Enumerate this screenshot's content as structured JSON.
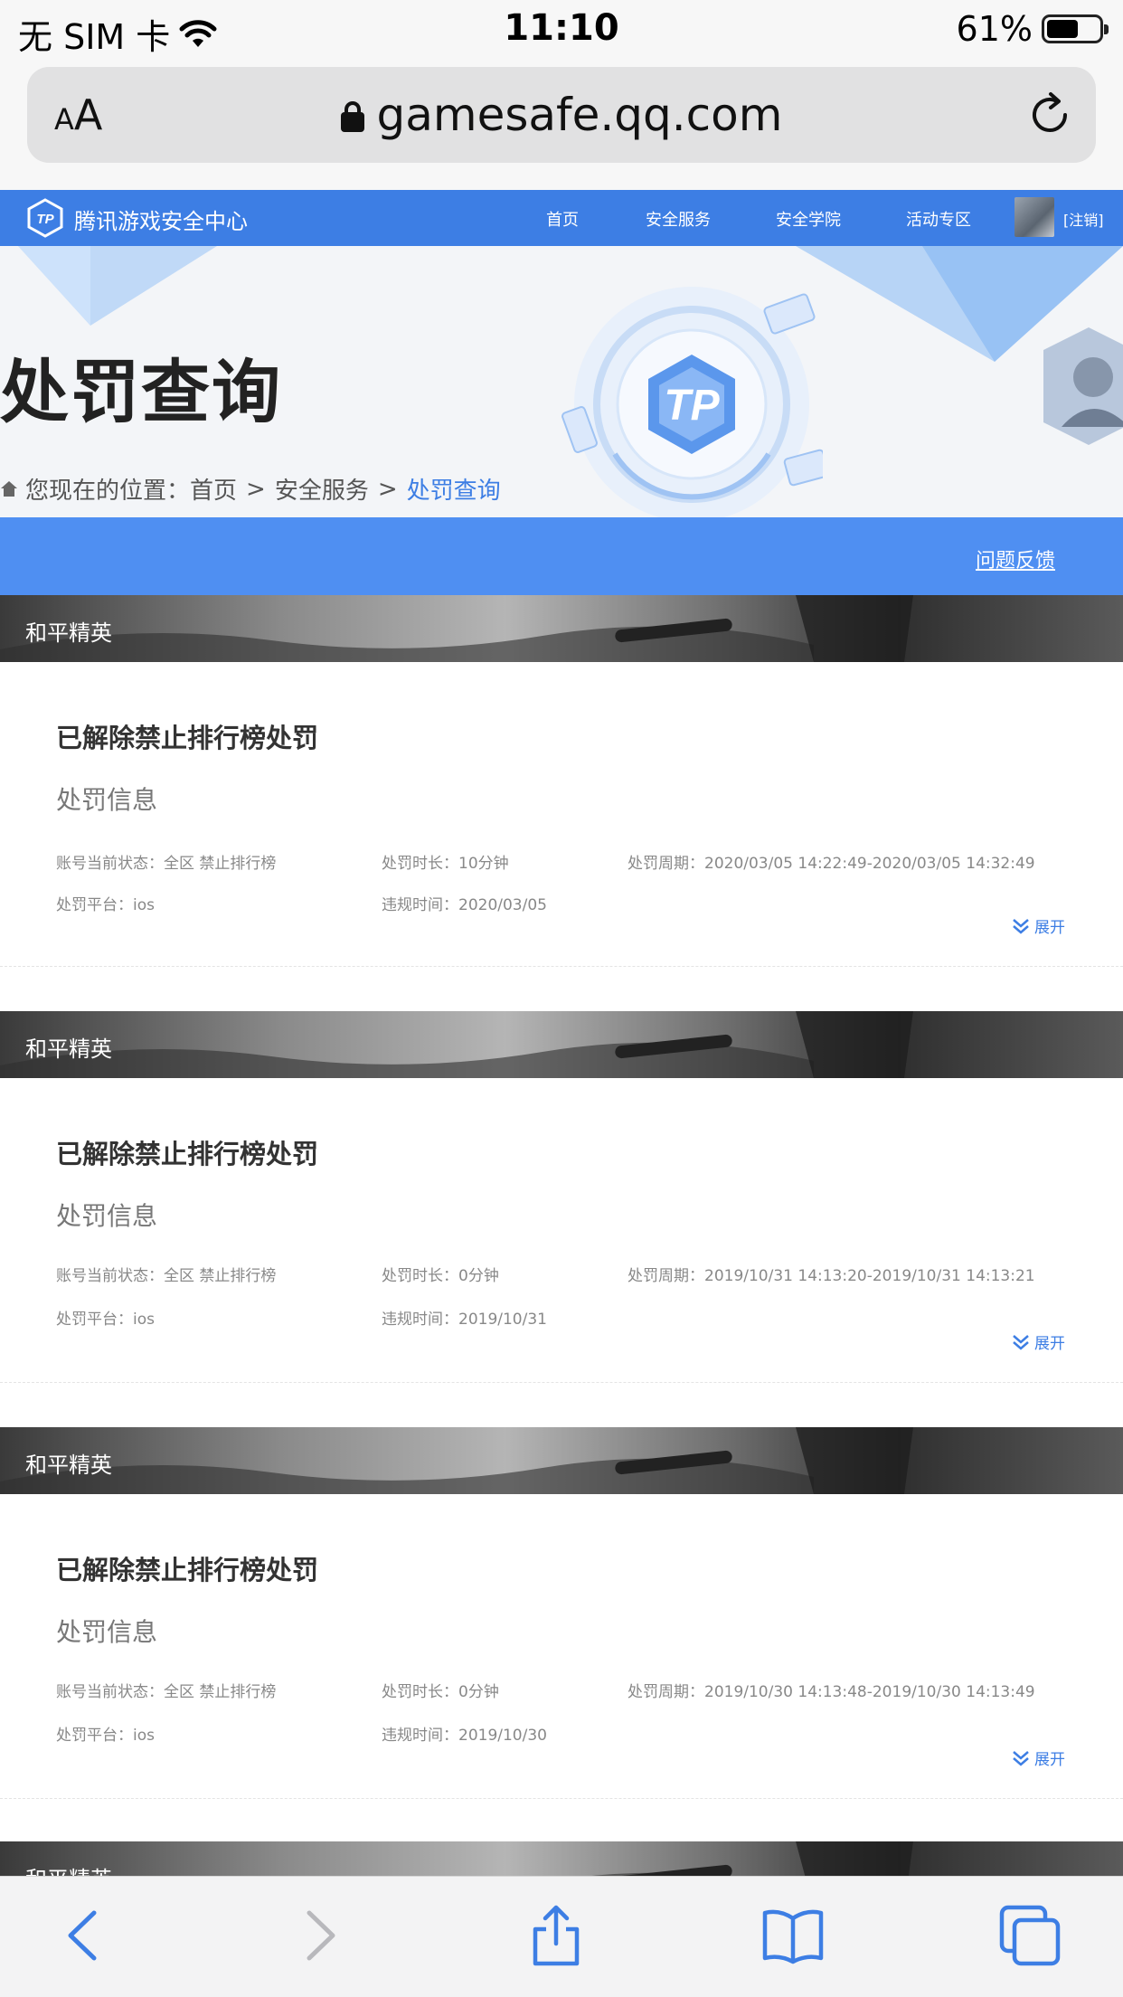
{
  "status_bar": {
    "carrier": "无 SIM 卡",
    "time": "11:10",
    "battery": "61%",
    "battery_level": 0.61
  },
  "safari": {
    "reader_label_small": "A",
    "reader_label_large": "A",
    "url": "gamesafe.qq.com"
  },
  "site": {
    "name": "腾讯游戏安全中心",
    "nav": [
      "首页",
      "安全服务",
      "安全学院",
      "活动专区"
    ],
    "logout": "[注销]"
  },
  "hero": {
    "title": "处罚查询",
    "breadcrumb_prefix": "您现在的位置：",
    "crumb_home": "首页",
    "sep": ">",
    "crumb_service": "安全服务",
    "crumb_current": "处罚查询",
    "emblem_text": "TP"
  },
  "feedback": "问题反馈",
  "records": [
    {
      "game": "和平精英",
      "title": "已解除禁止排行榜处罚",
      "section": "处罚信息",
      "status_label": "账号当前状态：",
      "status_value": "全区 禁止排行榜",
      "duration_label": "处罚时长：",
      "duration_value": "10分钟",
      "period_label": "处罚周期：",
      "period_value": "2020/03/05 14:22:49-2020/03/05 14:32:49",
      "platform_label": "处罚平台：",
      "platform_value": "ios",
      "violation_label": "违规时间：",
      "violation_value": "2020/03/05",
      "expand": "展开"
    },
    {
      "game": "和平精英",
      "title": "已解除禁止排行榜处罚",
      "section": "处罚信息",
      "status_label": "账号当前状态：",
      "status_value": "全区 禁止排行榜",
      "duration_label": "处罚时长：",
      "duration_value": "0分钟",
      "period_label": "处罚周期：",
      "period_value": "2019/10/31 14:13:20-2019/10/31 14:13:21",
      "platform_label": "处罚平台：",
      "platform_value": "ios",
      "violation_label": "违规时间：",
      "violation_value": "2019/10/31",
      "expand": "展开"
    },
    {
      "game": "和平精英",
      "title": "已解除禁止排行榜处罚",
      "section": "处罚信息",
      "status_label": "账号当前状态：",
      "status_value": "全区 禁止排行榜",
      "duration_label": "处罚时长：",
      "duration_value": "0分钟",
      "period_label": "处罚周期：",
      "period_value": "2019/10/30 14:13:48-2019/10/30 14:13:49",
      "platform_label": "处罚平台：",
      "platform_value": "ios",
      "violation_label": "违规时间：",
      "violation_value": "2019/10/30",
      "expand": "展开"
    },
    {
      "game": "和平精英"
    }
  ],
  "toolbar": {
    "icons": [
      "back-icon",
      "forward-icon",
      "share-icon",
      "bookmarks-icon",
      "tabs-icon"
    ]
  },
  "colors": {
    "accent": "#3d7ee4",
    "feedback_bar": "#4f8ff2",
    "text": "#333333"
  }
}
